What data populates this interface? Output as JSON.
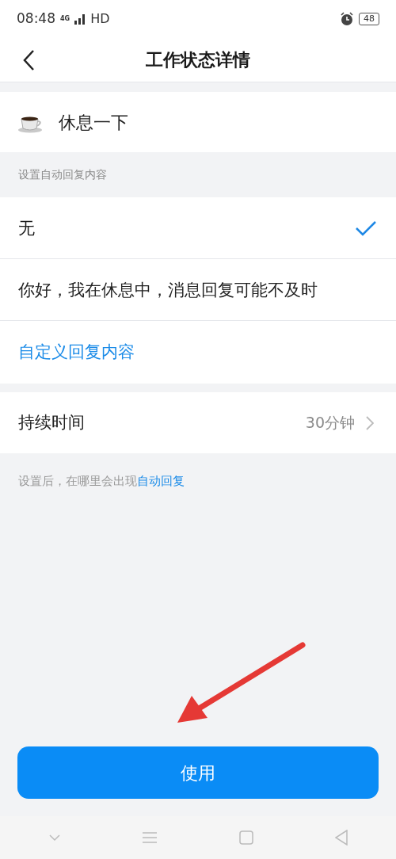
{
  "status_bar": {
    "time": "08:48",
    "network": "4G",
    "hd": "HD",
    "battery": "48"
  },
  "header": {
    "title": "工作状态详情"
  },
  "current_status": {
    "label": "休息一下"
  },
  "reply_section": {
    "heading": "设置自动回复内容",
    "options": [
      {
        "text": "无",
        "selected": true
      },
      {
        "text": "你好，我在休息中，消息回复可能不及时",
        "selected": false
      }
    ],
    "custom_link": "自定义回复内容"
  },
  "duration": {
    "label": "持续时间",
    "value": "30分钟"
  },
  "note": {
    "text": "设置后，在哪里会出现",
    "link": "自动回复"
  },
  "use_button": "使用"
}
